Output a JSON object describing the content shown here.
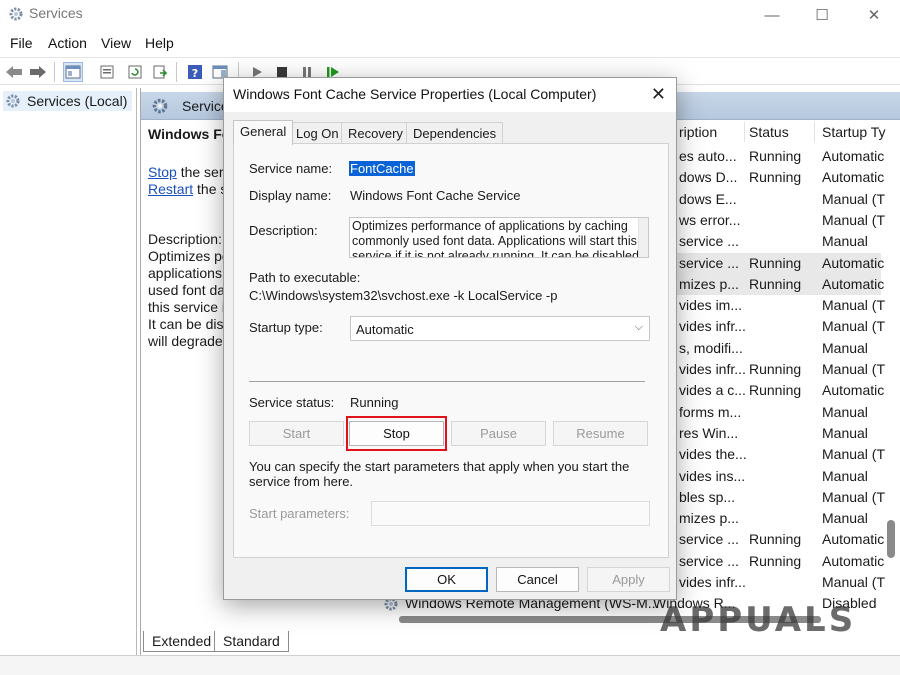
{
  "window": {
    "title": "Services"
  },
  "menu": [
    "File",
    "Action",
    "View",
    "Help"
  ],
  "tree": {
    "root_label": "Services (Local)"
  },
  "content": {
    "header_label": "Services",
    "service_heading": "Windows Fo",
    "stop_link": "Stop",
    "stop_suffix": " the serv",
    "restart_link": "Restart",
    "restart_suffix": " the se",
    "description_label": "Description:",
    "description_text": "Optimizes pe\napplications\nused font dat\nthis service if\nIt can be disa\nwill degrade"
  },
  "list": {
    "columns": [
      "ription",
      "Status",
      "Startup Ty"
    ],
    "rows": [
      {
        "desc": "es auto...",
        "status": "Running",
        "startup": "Automatic",
        "selected": false
      },
      {
        "desc": "dows D...",
        "status": "Running",
        "startup": "Automatic",
        "selected": false
      },
      {
        "desc": "dows E...",
        "status": "",
        "startup": "Manual (T",
        "selected": false
      },
      {
        "desc": "ws error...",
        "status": "",
        "startup": "Manual (T",
        "selected": false
      },
      {
        "desc": "service ...",
        "status": "",
        "startup": "Manual",
        "selected": false
      },
      {
        "desc": "service ...",
        "status": "Running",
        "startup": "Automatic",
        "selected": true
      },
      {
        "desc": "mizes p...",
        "status": "Running",
        "startup": "Automatic",
        "selected": true
      },
      {
        "desc": "vides im...",
        "status": "",
        "startup": "Manual (T",
        "selected": false
      },
      {
        "desc": "vides infr...",
        "status": "",
        "startup": "Manual (T",
        "selected": false
      },
      {
        "desc": "s, modifi...",
        "status": "",
        "startup": "Manual",
        "selected": false
      },
      {
        "desc": "vides infr...",
        "status": "Running",
        "startup": "Manual (T",
        "selected": false
      },
      {
        "desc": "vides a c...",
        "status": "Running",
        "startup": "Automatic",
        "selected": false
      },
      {
        "desc": "forms m...",
        "status": "",
        "startup": "Manual",
        "selected": false
      },
      {
        "desc": "res Win...",
        "status": "",
        "startup": "Manual",
        "selected": false
      },
      {
        "desc": "vides the...",
        "status": "",
        "startup": "Manual (T",
        "selected": false
      },
      {
        "desc": "vides ins...",
        "status": "",
        "startup": "Manual",
        "selected": false
      },
      {
        "desc": "bles sp...",
        "status": "",
        "startup": "Manual (T",
        "selected": false
      },
      {
        "desc": "mizes p...",
        "status": "",
        "startup": "Manual",
        "selected": false
      },
      {
        "desc": "service ...",
        "status": "Running",
        "startup": "Automatic",
        "selected": false
      },
      {
        "desc": "service ...",
        "status": "Running",
        "startup": "Automatic",
        "selected": false
      },
      {
        "desc": "vides infr...",
        "status": "",
        "startup": "Manual (T",
        "selected": false
      }
    ],
    "last_row": {
      "name": "Windows Remote Management (WS-M...",
      "desc": "Windows R...",
      "startup": "Disabled"
    }
  },
  "bottom_tabs": [
    "Extended",
    "Standard"
  ],
  "watermark": "APPUALS",
  "dialog": {
    "title": "Windows Font Cache Service Properties (Local Computer)",
    "tabs": [
      "General",
      "Log On",
      "Recovery",
      "Dependencies"
    ],
    "active_tab": "General",
    "service_name_label": "Service name:",
    "service_name_value": "FontCache",
    "display_name_label": "Display name:",
    "display_name_value": "Windows Font Cache Service",
    "description_label": "Description:",
    "description_value": "Optimizes performance of applications by caching commonly used font data. Applications will start this service if it is not already running. It can be disabled",
    "path_label": "Path to executable:",
    "path_value": "C:\\Windows\\system32\\svchost.exe -k LocalService -p",
    "startup_type_label": "Startup type:",
    "startup_type_value": "Automatic",
    "service_status_label": "Service status:",
    "service_status_value": "Running",
    "buttons": {
      "start": "Start",
      "stop": "Stop",
      "pause": "Pause",
      "resume": "Resume"
    },
    "hint": "You can specify the start parameters that apply when you start the service from here.",
    "start_params_label": "Start parameters:",
    "start_params_value": "",
    "ok": "OK",
    "cancel": "Cancel",
    "apply": "Apply"
  },
  "colors": {
    "highlight": "#e0131b",
    "selection": "#0a63d6",
    "link": "#1a4fc2",
    "default_button": "#0067c0"
  }
}
